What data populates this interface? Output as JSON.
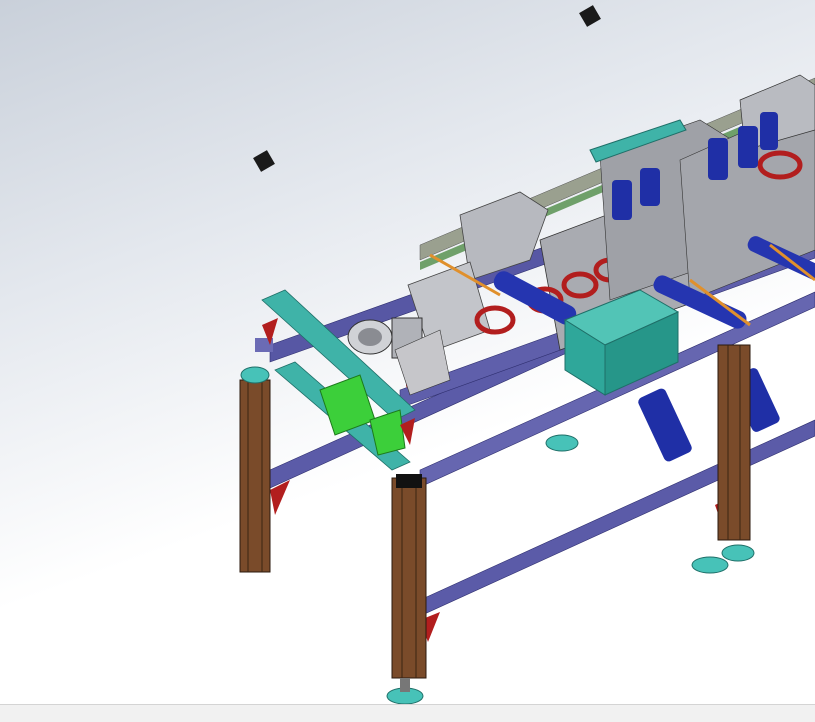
{
  "viewport": {
    "model": "conveyor-frame-assembly"
  },
  "colors": {
    "background_top": "#c9d0da",
    "background_bottom": "#ffffff",
    "frame_post": "#7a4b2a",
    "rail_blue": "#5b5ba8",
    "profile_teal": "#3fb3a8",
    "bracket_red": "#b21e1e",
    "housing_teal": "#2fa79a",
    "motor_blue": "#1f2fa6",
    "foot_teal": "#47c2b8",
    "steel_gray": "#b7b9bf",
    "guard_green": "#3ccf3a",
    "rod_orange": "#e0902c"
  },
  "icons": [
    "view-marker-icon",
    "view-marker-icon"
  ]
}
